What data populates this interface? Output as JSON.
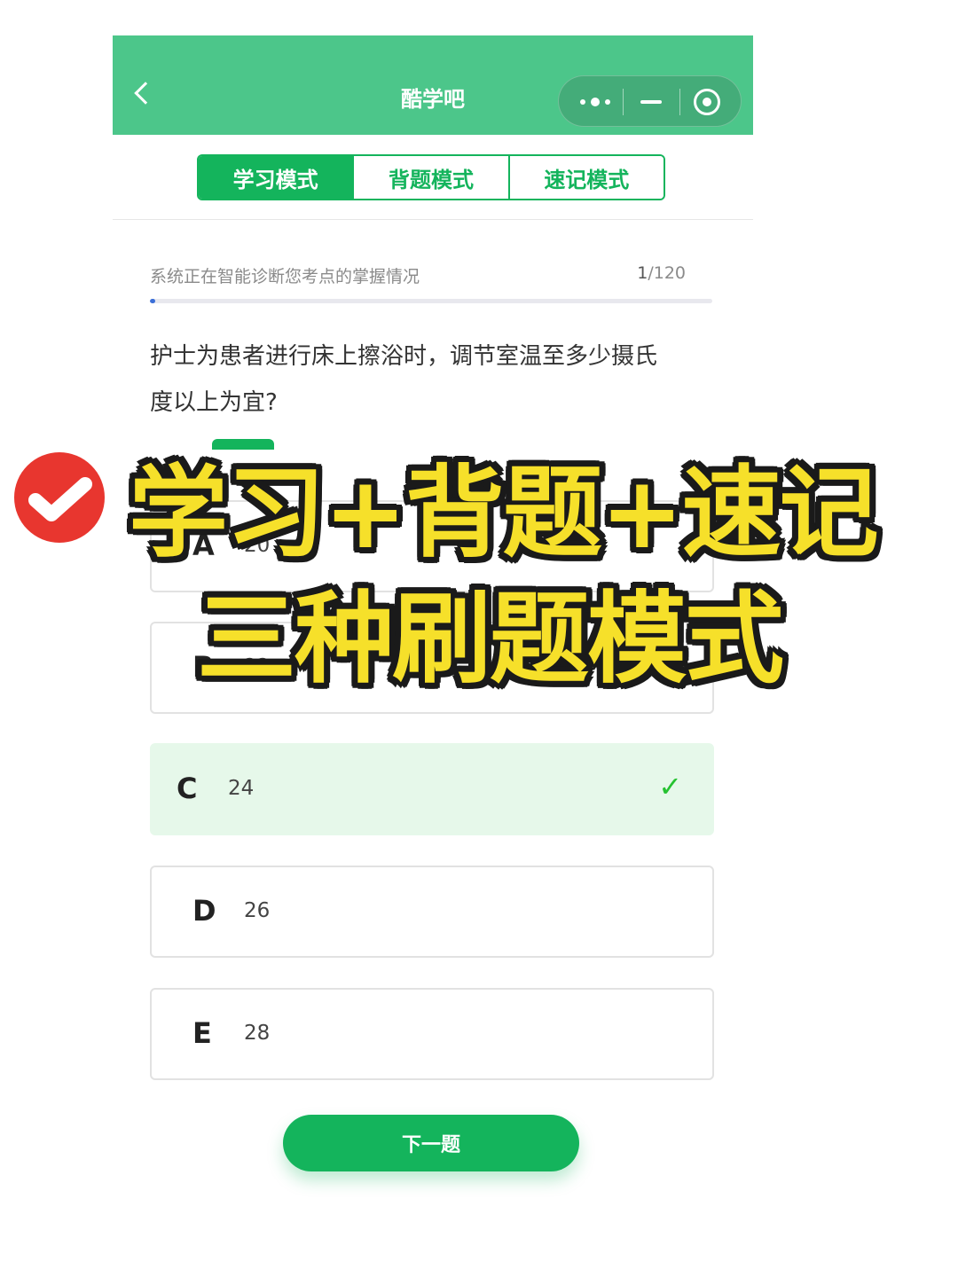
{
  "header": {
    "title": "酷学吧"
  },
  "tabs": [
    {
      "label": "学习模式",
      "active": true
    },
    {
      "label": "背题模式",
      "active": false
    },
    {
      "label": "速记模式",
      "active": false
    }
  ],
  "status": {
    "text": "系统正在智能诊断您考点的掌握情况",
    "current": "1",
    "total": "/120",
    "progress_fraction": 0.0083
  },
  "question": {
    "line1": "护士为患者进行床上擦浴时，调节室温至多少摄氏",
    "line2": "度以上为宜?"
  },
  "options": [
    {
      "letter": "A",
      "text": "20",
      "state": "default"
    },
    {
      "letter": "B",
      "text": "22",
      "state": "default"
    },
    {
      "letter": "C",
      "text": "24",
      "state": "correct"
    },
    {
      "letter": "D",
      "text": "26",
      "state": "default"
    },
    {
      "letter": "E",
      "text": "28",
      "state": "default"
    }
  ],
  "correct_mark": "✓",
  "next_button": {
    "label": "下一题"
  },
  "promo": {
    "line1": "学习+背题+速记",
    "line2": "三种刷题模式"
  },
  "colors": {
    "header": "#4cc68a",
    "accent": "#14b45c",
    "correct_bg": "#e6f8ea",
    "promo_text": "#f6e02a",
    "badge": "#e8362f"
  },
  "icons": {
    "back": "chevron-left-icon",
    "more": "more-dots-icon",
    "minimize": "minus-icon",
    "close": "target-circle-icon",
    "badge": "checkmark-badge-icon"
  }
}
